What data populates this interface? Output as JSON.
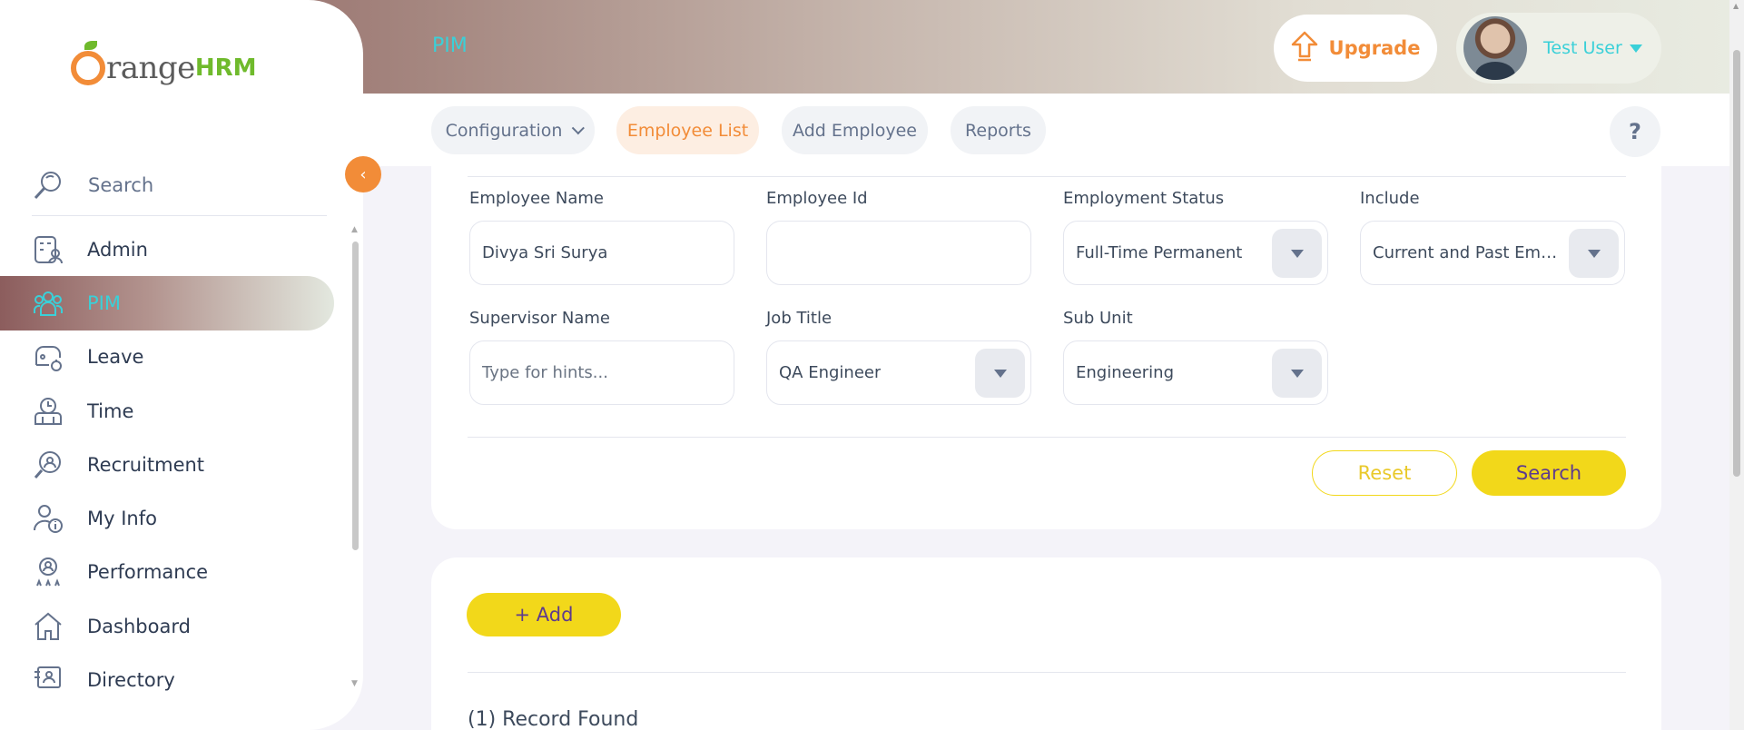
{
  "header": {
    "page_title": "PIM",
    "upgrade_label": "Upgrade",
    "user_name": "Test User"
  },
  "sidebar": {
    "logo_text": "range",
    "logo_suffix": "HRM",
    "search_label": "Search",
    "toggle_glyph": "‹",
    "items": [
      {
        "label": "Admin",
        "icon": "admin-icon"
      },
      {
        "label": "PIM",
        "icon": "pim-icon"
      },
      {
        "label": "Leave",
        "icon": "leave-icon"
      },
      {
        "label": "Time",
        "icon": "time-icon"
      },
      {
        "label": "Recruitment",
        "icon": "recruitment-icon"
      },
      {
        "label": "My Info",
        "icon": "my-info-icon"
      },
      {
        "label": "Performance",
        "icon": "performance-icon"
      },
      {
        "label": "Dashboard",
        "icon": "dashboard-icon"
      },
      {
        "label": "Directory",
        "icon": "directory-icon"
      }
    ]
  },
  "topnav": {
    "configuration": "Configuration",
    "employee_list": "Employee List",
    "add_employee": "Add Employee",
    "reports": "Reports",
    "help": "?"
  },
  "filters": {
    "employee_name": {
      "label": "Employee Name",
      "value": "Divya Sri Surya"
    },
    "employee_id": {
      "label": "Employee Id",
      "value": ""
    },
    "employment_status": {
      "label": "Employment Status",
      "value": "Full-Time Permanent"
    },
    "include": {
      "label": "Include",
      "value": "Current and Past Empl..."
    },
    "supervisor_name": {
      "label": "Supervisor Name",
      "placeholder": "Type for hints..."
    },
    "job_title": {
      "label": "Job Title",
      "value": "QA Engineer"
    },
    "sub_unit": {
      "label": "Sub Unit",
      "value": "Engineering"
    },
    "reset_label": "Reset",
    "search_label": "Search"
  },
  "results": {
    "add_label": "+  Add",
    "record_count": "(1) Record Found"
  },
  "colors": {
    "accent_orange": "#f28c38",
    "accent_teal": "#3ad0d8",
    "accent_yellow": "#f2d81a",
    "text_purple": "#5d3b8e"
  }
}
